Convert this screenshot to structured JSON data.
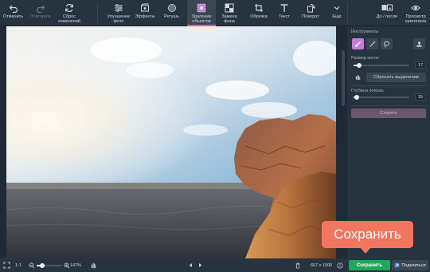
{
  "toolbar": {
    "undo": "Отменить",
    "redo": "Повторить",
    "reset": "Сброс изменений",
    "enhance": "Улучшение фото",
    "effects": "Эффекты",
    "retouch": "Ретушь",
    "remove_objects": "Удаление объектов",
    "replace_bg": "Замена фона",
    "crop": "Обрезка",
    "text": "Текст",
    "rotate": "Поворот",
    "more": "Ещё",
    "before_after": "До / после",
    "view_original": "Просмотр оригинала"
  },
  "panel": {
    "tools_label": "Инструменты",
    "brush_size_label": "Размер кисти:",
    "brush_size_value": "17",
    "reset_selection": "Сбросить выделение",
    "search_depth_label": "Глубина поиска:",
    "search_depth_value": "15",
    "erase_button": "Стереть"
  },
  "bottom": {
    "zoom_ratio": "1:1",
    "zoom_percent": "147%",
    "image_size": "667 x 1000",
    "save": "Сохранить",
    "share": "Поделиться"
  },
  "callout": {
    "text": "Сохранить"
  },
  "colors": {
    "accent_save": "#22a65b",
    "callout": "#f2755f",
    "active_tool": "#c77dd9",
    "toolbar_bg": "#27333f"
  }
}
